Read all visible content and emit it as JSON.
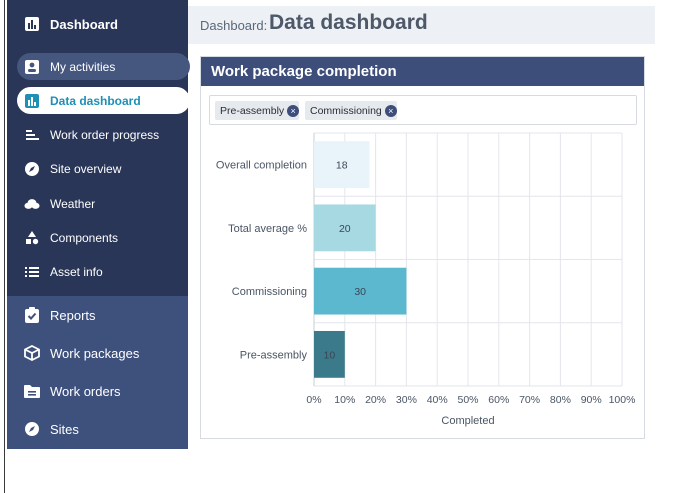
{
  "sidebar": {
    "header": {
      "label": "Dashboard"
    },
    "items": [
      {
        "label": "My activities",
        "icon": "person-badge-icon",
        "state": "hover"
      },
      {
        "label": "Data dashboard",
        "icon": "bar-chart-icon",
        "state": "active"
      },
      {
        "label": "Work order progress",
        "icon": "progress-bars-icon",
        "state": "normal"
      },
      {
        "label": "Site overview",
        "icon": "compass-icon",
        "state": "normal"
      },
      {
        "label": "Weather",
        "icon": "cloud-icon",
        "state": "normal"
      },
      {
        "label": "Components",
        "icon": "shapes-icon",
        "state": "normal"
      },
      {
        "label": "Asset info",
        "icon": "list-icon",
        "state": "normal"
      }
    ],
    "sections": [
      {
        "label": "Reports",
        "icon": "clipboard-check-icon"
      },
      {
        "label": "Work packages",
        "icon": "box-icon"
      },
      {
        "label": "Work orders",
        "icon": "folder-icon"
      },
      {
        "label": "Sites",
        "icon": "compass-icon"
      }
    ]
  },
  "header": {
    "breadcrumb": "Dashboard:",
    "title": "Data dashboard"
  },
  "panel": {
    "title": "Work package completion",
    "filters": [
      "Pre-assembly",
      "Commissioning"
    ]
  },
  "colors": {
    "sidebar_top": "#2a3658",
    "sidebar_bottom": "#3e507c",
    "panel_header": "#3e4e7a",
    "active_text": "#1f8fb6",
    "bar_colors": [
      "#e9f3fa",
      "#a6d9e1",
      "#5bb8cf",
      "#3a7a8a"
    ]
  },
  "chart_data": {
    "type": "bar",
    "orientation": "horizontal",
    "categories": [
      "Overall completion",
      "Total average %",
      "Commissioning",
      "Pre-assembly"
    ],
    "values": [
      18,
      20,
      30,
      10
    ],
    "data_labels": [
      "18",
      "20",
      "30",
      "10"
    ],
    "xlabel": "Completed",
    "xlim": [
      0,
      100
    ],
    "x_ticks": [
      "0%",
      "10%",
      "20%",
      "30%",
      "40%",
      "50%",
      "60%",
      "70%",
      "80%",
      "90%",
      "100%"
    ],
    "grid": true,
    "legend": "none"
  }
}
